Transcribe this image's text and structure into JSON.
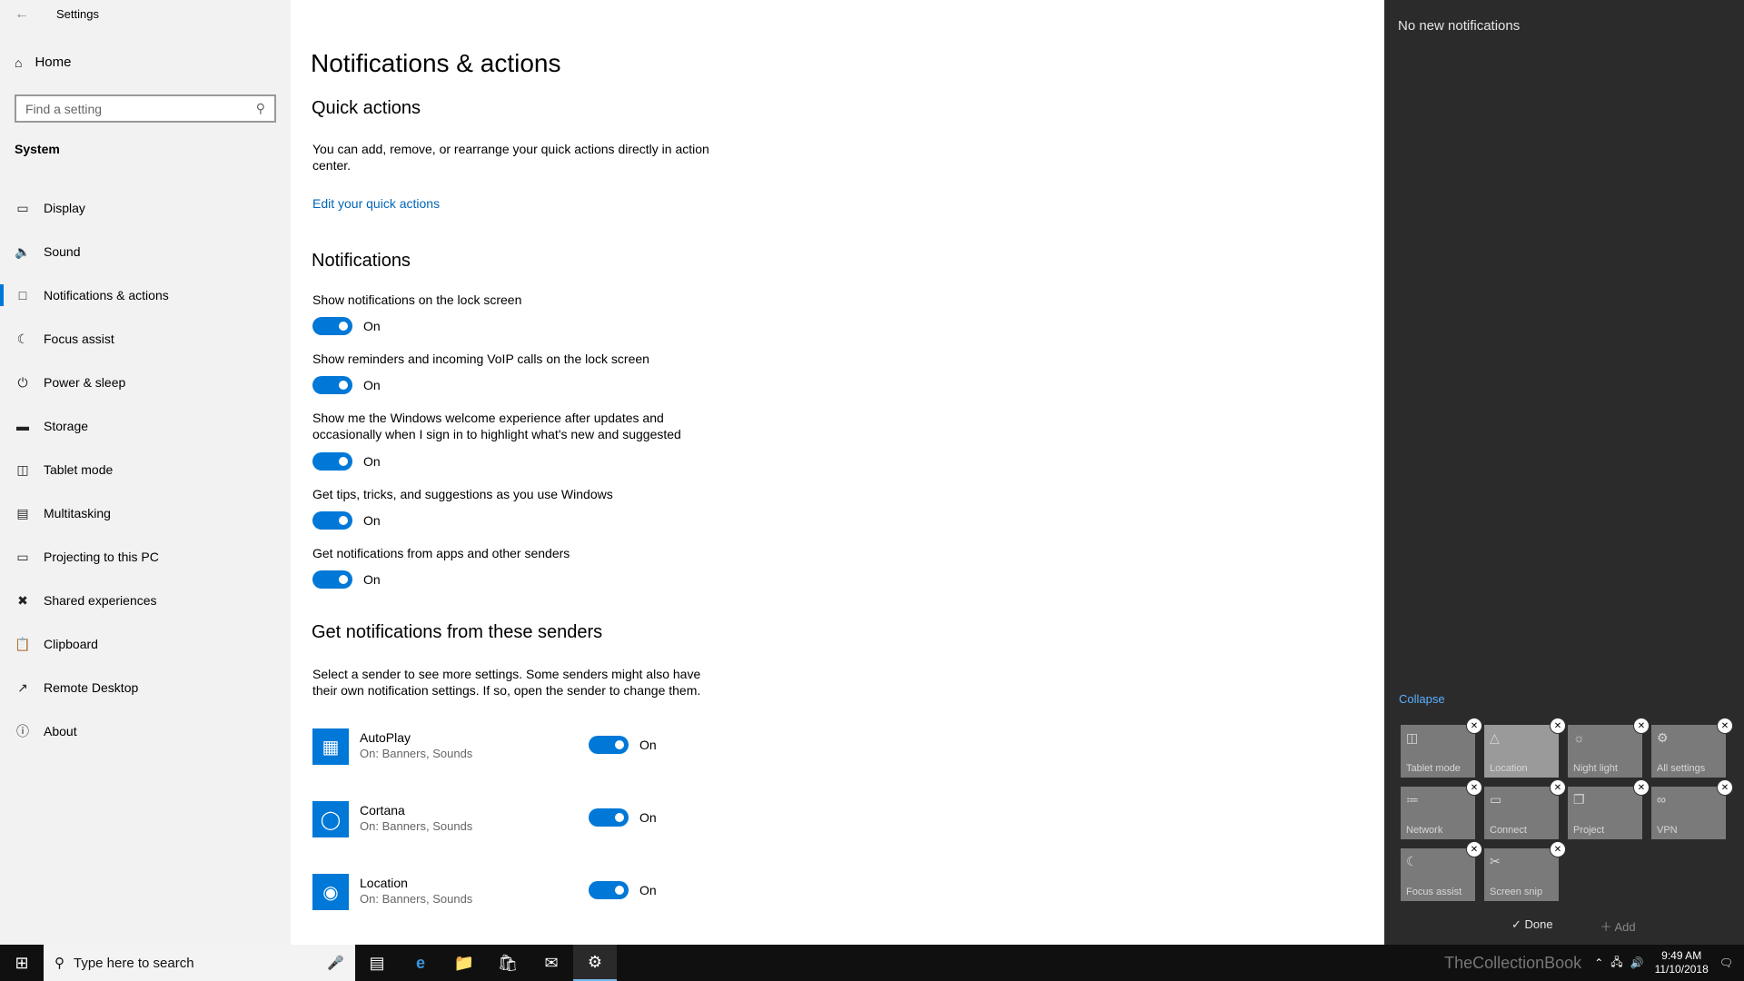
{
  "window": {
    "title": "Settings",
    "back_icon": "back-arrow-icon"
  },
  "sidebar": {
    "home_label": "Home",
    "search_placeholder": "Find a setting",
    "section_label": "System",
    "items": [
      {
        "label": "Display",
        "icon": "display-icon"
      },
      {
        "label": "Sound",
        "icon": "sound-icon"
      },
      {
        "label": "Notifications & actions",
        "icon": "notifications-icon",
        "active": true
      },
      {
        "label": "Focus assist",
        "icon": "moon-icon"
      },
      {
        "label": "Power & sleep",
        "icon": "power-icon"
      },
      {
        "label": "Storage",
        "icon": "storage-icon"
      },
      {
        "label": "Tablet mode",
        "icon": "tablet-icon"
      },
      {
        "label": "Multitasking",
        "icon": "multitasking-icon"
      },
      {
        "label": "Projecting to this PC",
        "icon": "projecting-icon"
      },
      {
        "label": "Shared experiences",
        "icon": "shared-icon"
      },
      {
        "label": "Clipboard",
        "icon": "clipboard-icon"
      },
      {
        "label": "Remote Desktop",
        "icon": "remote-desktop-icon"
      },
      {
        "label": "About",
        "icon": "info-icon"
      }
    ]
  },
  "main": {
    "title": "Notifications & actions",
    "quick_actions": {
      "heading": "Quick actions",
      "description": "You can add, remove, or rearrange your quick actions directly in action center.",
      "link": "Edit your quick actions"
    },
    "notifications": {
      "heading": "Notifications",
      "settings": [
        {
          "label": "Show notifications on the lock screen",
          "state": "On"
        },
        {
          "label": "Show reminders and incoming VoIP calls on the lock screen",
          "state": "On"
        },
        {
          "label": "Show me the Windows welcome experience after updates and occasionally when I sign in to highlight what's new and suggested",
          "state": "On"
        },
        {
          "label": "Get tips, tricks, and suggestions as you use Windows",
          "state": "On"
        },
        {
          "label": "Get notifications from apps and other senders",
          "state": "On"
        }
      ]
    },
    "senders": {
      "heading": "Get notifications from these senders",
      "description": "Select a sender to see more settings. Some senders might also have their own notification settings. If so, open the sender to change them.",
      "items": [
        {
          "name": "AutoPlay",
          "sub": "On: Banners, Sounds",
          "state": "On"
        },
        {
          "name": "Cortana",
          "sub": "On: Banners, Sounds",
          "state": "On"
        },
        {
          "name": "Location",
          "sub": "On: Banners, Sounds",
          "state": "On"
        }
      ]
    }
  },
  "action_center": {
    "no_notifications": "No new notifications",
    "collapse": "Collapse",
    "tiles": [
      {
        "label": "Tablet mode",
        "icon": "tablet-mode-icon"
      },
      {
        "label": "Location",
        "icon": "location-icon"
      },
      {
        "label": "Night light",
        "icon": "night-light-icon"
      },
      {
        "label": "All settings",
        "icon": "gear-icon"
      },
      {
        "label": "Network",
        "icon": "network-icon"
      },
      {
        "label": "Connect",
        "icon": "connect-icon"
      },
      {
        "label": "Project",
        "icon": "project-icon"
      },
      {
        "label": "VPN",
        "icon": "vpn-icon"
      },
      {
        "label": "Focus assist",
        "icon": "moon-icon"
      },
      {
        "label": "Screen snip",
        "icon": "scissors-icon"
      }
    ],
    "done": "Done",
    "add": "Add"
  },
  "taskbar": {
    "search_placeholder": "Type here to search",
    "time": "9:49 AM",
    "date": "11/10/2018",
    "watermark": "TheCollectionBook"
  },
  "colors": {
    "accent": "#0078d7",
    "link": "#0067b8",
    "action_center_bg": "#2b2b2b",
    "taskbar_bg": "#101010"
  }
}
